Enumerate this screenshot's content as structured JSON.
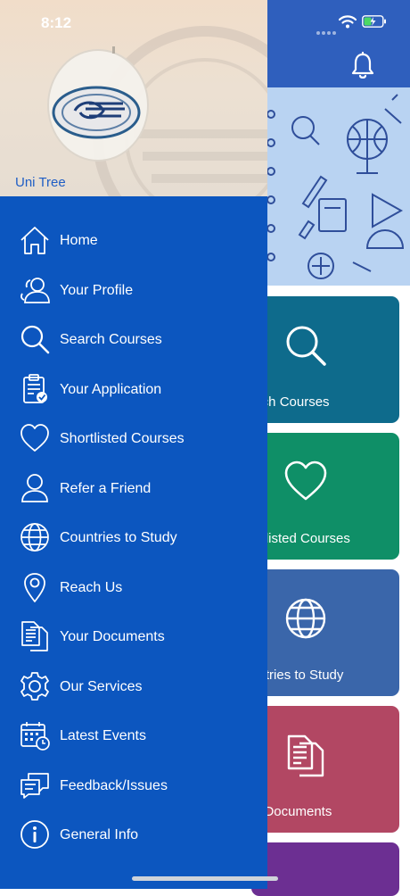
{
  "status_bar": {
    "time": "8:12"
  },
  "colors": {
    "drawer_bg": "#0c56bf",
    "header_bg": "#2f5fbd",
    "tile_search": "#0e6b8c",
    "tile_shortlist": "#0f8f67",
    "tile_countries": "#3a66aa",
    "tile_documents": "#b24763",
    "tile_next": "#6c2f92"
  },
  "drawer": {
    "brand": "Uni Tree",
    "items": [
      {
        "label": "Home",
        "icon": "home-icon"
      },
      {
        "label": "Your Profile",
        "icon": "profile-icon"
      },
      {
        "label": "Search Courses",
        "icon": "search-icon"
      },
      {
        "label": "Your Application",
        "icon": "clipboard-icon"
      },
      {
        "label": "Shortlisted Courses",
        "icon": "heart-icon"
      },
      {
        "label": "Refer a Friend",
        "icon": "user-icon"
      },
      {
        "label": "Countries to Study",
        "icon": "globe-icon"
      },
      {
        "label": "Reach Us",
        "icon": "location-pin-icon"
      },
      {
        "label": "Your Documents",
        "icon": "documents-icon"
      },
      {
        "label": "Our Services",
        "icon": "gear-icon"
      },
      {
        "label": "Latest Events",
        "icon": "calendar-icon"
      },
      {
        "label": "Feedback/Issues",
        "icon": "chat-icon"
      },
      {
        "label": "General Info",
        "icon": "info-icon"
      }
    ]
  },
  "main": {
    "tiles": [
      {
        "label": "Search Courses",
        "icon": "search-icon"
      },
      {
        "label": "Shortlisted Courses",
        "icon": "heart-icon"
      },
      {
        "label": "Countries to Study",
        "icon": "globe-icon"
      },
      {
        "label": "Your Documents",
        "icon": "documents-icon"
      }
    ]
  }
}
